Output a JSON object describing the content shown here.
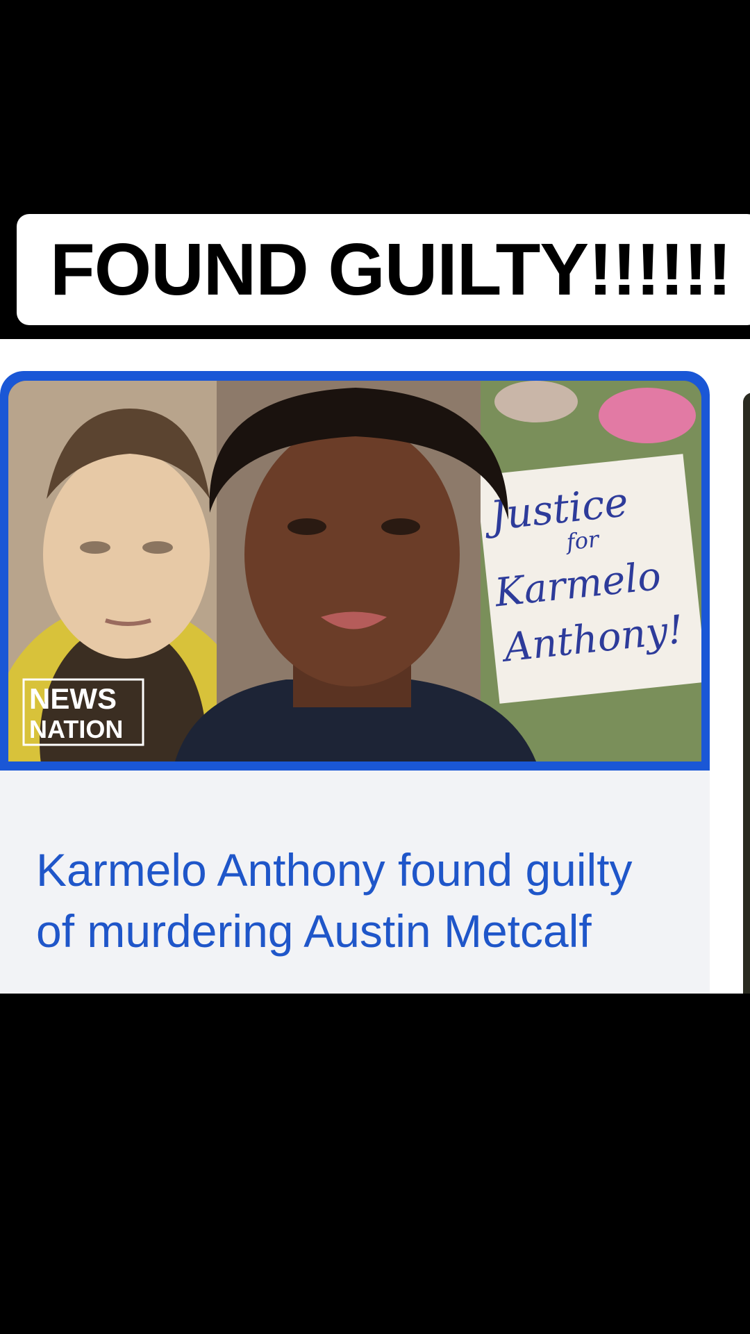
{
  "caption": {
    "text": "FOUND GUILTY!!!!!!"
  },
  "card": {
    "headline": "Karmelo Anthony found guilty of murdering Austin Metcalf",
    "thumbnail": {
      "source_logo": [
        "NEWS",
        "NATION"
      ],
      "sign_lines": [
        "Justice",
        "for",
        "Karmelo",
        "Anthony!"
      ]
    }
  },
  "colors": {
    "background": "#000000",
    "caption_bg": "#ffffff",
    "card_bg": "#f2f3f6",
    "card_border": "#1a57d6",
    "headline": "#1f56c9"
  }
}
